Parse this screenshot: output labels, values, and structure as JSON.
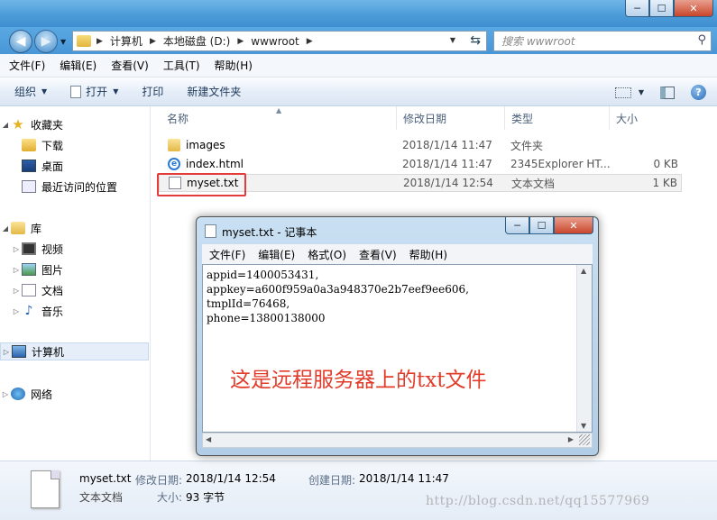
{
  "window": {
    "caption": {
      "minimize": "─",
      "maximize": "☐",
      "close": "✕"
    }
  },
  "address": {
    "crumbs": [
      "计算机",
      "本地磁盘 (D:)",
      "wwwroot"
    ],
    "search_placeholder": "搜索 wwwroot"
  },
  "menu": [
    "文件(F)",
    "编辑(E)",
    "查看(V)",
    "工具(T)",
    "帮助(H)"
  ],
  "toolbar": {
    "organize": "组织",
    "open": "打开",
    "print": "打印",
    "new_folder": "新建文件夹"
  },
  "nav": {
    "favorites": "收藏夹",
    "downloads": "下载",
    "desktop": "桌面",
    "recent": "最近访问的位置",
    "libraries": "库",
    "videos": "视频",
    "pictures": "图片",
    "documents": "文档",
    "music": "音乐",
    "computer": "计算机",
    "network": "网络"
  },
  "columns": {
    "name": "名称",
    "date": "修改日期",
    "type": "类型",
    "size": "大小"
  },
  "files": [
    {
      "name": "images",
      "date": "2018/1/14 11:47",
      "type": "文件夹",
      "size": ""
    },
    {
      "name": "index.html",
      "date": "2018/1/14 11:47",
      "type": "2345Explorer HT...",
      "size": "0 KB"
    },
    {
      "name": "myset.txt",
      "date": "2018/1/14 12:54",
      "type": "文本文档",
      "size": "1 KB"
    }
  ],
  "details": {
    "name": "myset.txt",
    "type": "文本文档",
    "modified_label": "修改日期:",
    "modified_value": "2018/1/14 12:54",
    "created_label": "创建日期:",
    "created_value": "2018/1/14 11:47",
    "size_label": "大小:",
    "size_value": "93 字节"
  },
  "watermark": "http://blog.csdn.net/qq15577969",
  "notepad": {
    "title": "myset.txt - 记事本",
    "menu": [
      "文件(F)",
      "编辑(E)",
      "格式(O)",
      "查看(V)",
      "帮助(H)"
    ],
    "content": "appid=1400053431,\nappkey=a600f959a0a3a948370e2b7eef9ee606,\ntmplId=76468,\nphone=13800138000",
    "note": "这是远程服务器上的txt文件"
  }
}
